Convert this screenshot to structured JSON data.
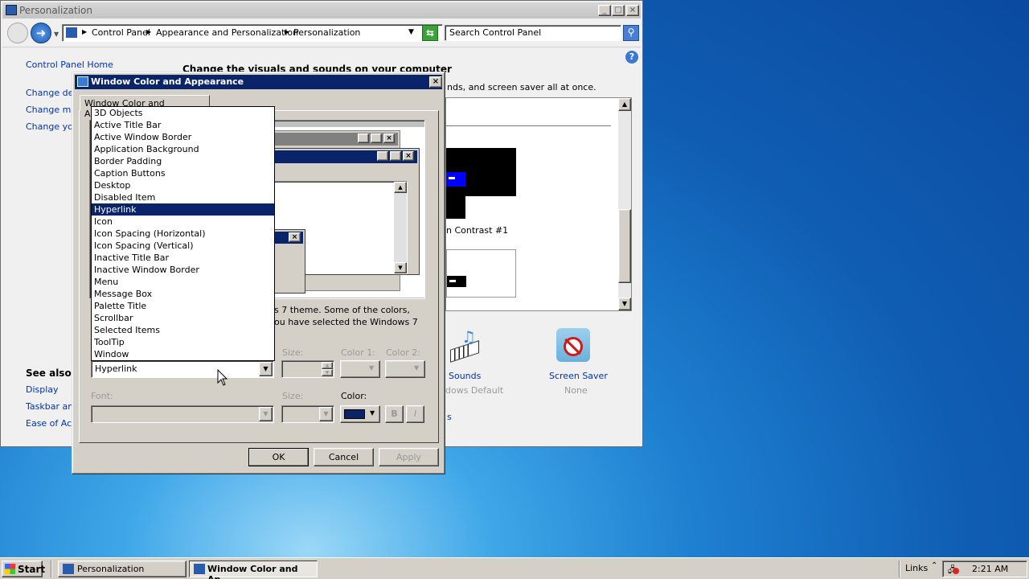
{
  "personalization": {
    "title": "Personalization",
    "breadcrumb": [
      "Control Panel",
      "Appearance and Personalization",
      "Personalization"
    ],
    "search_placeholder": "Search Control Panel",
    "sidebar": {
      "home": "Control Panel Home",
      "links": [
        "Change des",
        "Change mou",
        "Change you"
      ],
      "see_also_title": "See also",
      "see_also": [
        "Display",
        "Taskbar and",
        "Ease of Acc"
      ]
    },
    "main_heading": "Change the visuals and sounds on your computer",
    "main_sub": "nds, and screen saver all at once.",
    "theme_label": "n Contrast #1",
    "bottom_items": {
      "sounds": "Sounds",
      "sounds_sub": "dows Default",
      "screensaver": "Screen Saver",
      "screensaver_sub": "None",
      "s_fragment": "s"
    }
  },
  "dialog": {
    "title": "Window Color and Appearance",
    "tab": "Window Color and Appearance",
    "info_text_1": "s 7 theme.  Some of the colors,",
    "info_text_2": "ou have selected the Windows 7",
    "item_dropdown_value": "Hyperlink",
    "items": [
      "3D Objects",
      "Active Title Bar",
      "Active Window Border",
      "Application Background",
      "Border Padding",
      "Caption Buttons",
      "Desktop",
      "Disabled Item",
      "Hyperlink",
      "Icon",
      "Icon Spacing (Horizontal)",
      "Icon Spacing (Vertical)",
      "Inactive Title Bar",
      "Inactive Window Border",
      "Menu",
      "Message Box",
      "Palette Title",
      "Scrollbar",
      "Selected Items",
      "ToolTip",
      "Window"
    ],
    "selected_item": "Hyperlink",
    "size_label": "Size:",
    "color1_label": "Color 1:",
    "color2_label": "Color 2:",
    "font_label": "Font:",
    "size2_label": "Size:",
    "color_label": "Color:",
    "bold_label": "B",
    "italic_label": "I",
    "ok": "OK",
    "cancel": "Cancel",
    "apply": "Apply",
    "color_swatch": "#0a246a"
  },
  "taskbar": {
    "start": "Start",
    "tasks": [
      "Personalization",
      "Window Color and Ap..."
    ],
    "links": "Links",
    "time": "2:21 AM"
  }
}
